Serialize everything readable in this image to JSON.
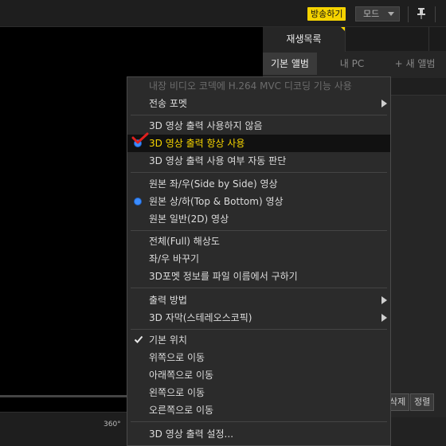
{
  "topbar": {
    "broadcast_label": "방송하기",
    "mode_label": "모드",
    "icons": [
      "pin-icon"
    ]
  },
  "panel": {
    "tab_playlist": "재생목록",
    "subtab_basic_album": "기본 앨범",
    "subtab_my_pc": "내 PC",
    "subtab_new_album": "+ 새 앨범",
    "btn_delete": "삭제",
    "btn_sort": "정렬"
  },
  "controls": {
    "vr_label": "360°"
  },
  "menu": {
    "items": [
      {
        "label": "내장 비디오 코덱에 H.264 MVC 디코딩 기능 사용",
        "state": "disabled"
      },
      {
        "label": "전송 포멧",
        "submenu": true
      },
      {
        "label": "3D 영상 출력 사용하지 않음"
      },
      {
        "label": "3D 영상 출력 항상 사용",
        "state": "selected-radio"
      },
      {
        "label": "3D 영상 출력 사용 여부 자동 판단"
      },
      {
        "label": "원본 좌/우(Side by Side) 영상"
      },
      {
        "label": "원본 상/하(Top & Bottom) 영상",
        "state": "radio"
      },
      {
        "label": "원본 일반(2D) 영상"
      },
      {
        "label": "전체(Full) 해상도"
      },
      {
        "label": "좌/우 바꾸기"
      },
      {
        "label": "3D포멧 정보를 파일 이름에서 구하기"
      },
      {
        "label": "출력 방법",
        "submenu": true
      },
      {
        "label": "3D 자막(스테레오스코픽)",
        "submenu": true
      },
      {
        "label": "기본 위치",
        "state": "checked"
      },
      {
        "label": "위쪽으로 이동"
      },
      {
        "label": "아래쪽으로 이동"
      },
      {
        "label": "왼쪽으로 이동"
      },
      {
        "label": "오른쪽으로 이동"
      },
      {
        "label": "3D 영상 출력 설정..."
      }
    ]
  },
  "colors": {
    "accent_yellow": "#f5d300",
    "radio_blue": "#3b8cff",
    "annotation_red": "#e0201e"
  }
}
